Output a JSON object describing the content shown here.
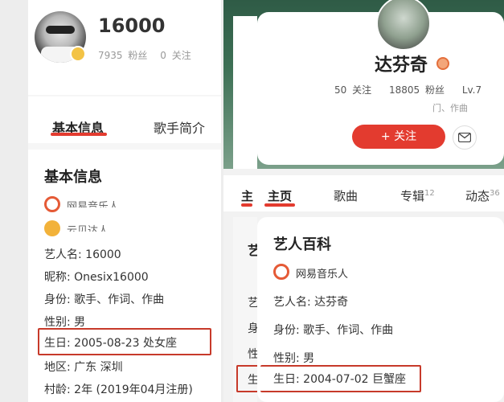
{
  "left": {
    "profile": {
      "name": "16000",
      "fans_count": "7935",
      "fans_label": "粉丝",
      "follow_count": "0",
      "follow_label": "关注"
    },
    "tabs": [
      {
        "label": "基本信息"
      },
      {
        "label": "歌手简介"
      }
    ],
    "section_title": "基本信息",
    "badges": [
      {
        "label": "网易音乐人"
      },
      {
        "label": "云贝达人"
      }
    ],
    "fields": [
      {
        "text": "艺人名: 16000"
      },
      {
        "text": "昵称: Onesix16000"
      },
      {
        "text": "身份: 歌手、作词、作曲"
      },
      {
        "text": "性别: 男"
      },
      {
        "text": "生日: 2005-08-23 处女座"
      },
      {
        "text": "地区: 广东 深圳"
      },
      {
        "text": "村龄: 2年 (2019年04月注册)"
      }
    ]
  },
  "right": {
    "profile": {
      "name": "达芬奇",
      "follow_count": "50",
      "follow_label": "关注",
      "fans_count": "18805",
      "fans_label": "粉丝",
      "level": "Lv.7",
      "subtitle_partial": "门、作曲",
      "follow_button": "+ 关注"
    },
    "tabs": [
      {
        "label": "主页"
      },
      {
        "label": "歌曲"
      },
      {
        "label": "专辑",
        "count": "12"
      },
      {
        "label": "动态",
        "count": "36"
      }
    ],
    "partial_left_tab": "主",
    "section_title": "艺人百科",
    "badge": "网易音乐人",
    "fields": [
      {
        "text": "艺人名: 达芬奇"
      },
      {
        "text": "身份: 歌手、作词、作曲"
      },
      {
        "text": "性别: 男"
      },
      {
        "text": "生日: 2004-07-02 巨蟹座"
      }
    ],
    "cutoff_chars": [
      "艺",
      "艺",
      "身",
      "性",
      "生"
    ]
  },
  "colors": {
    "accent_red": "#e33b2f",
    "highlight_box": "#c73a2a"
  },
  "icons": [
    "avatar",
    "badge-icon",
    "music-badge-icon",
    "cloud-badge-icon",
    "verified-icon",
    "mail-icon"
  ]
}
